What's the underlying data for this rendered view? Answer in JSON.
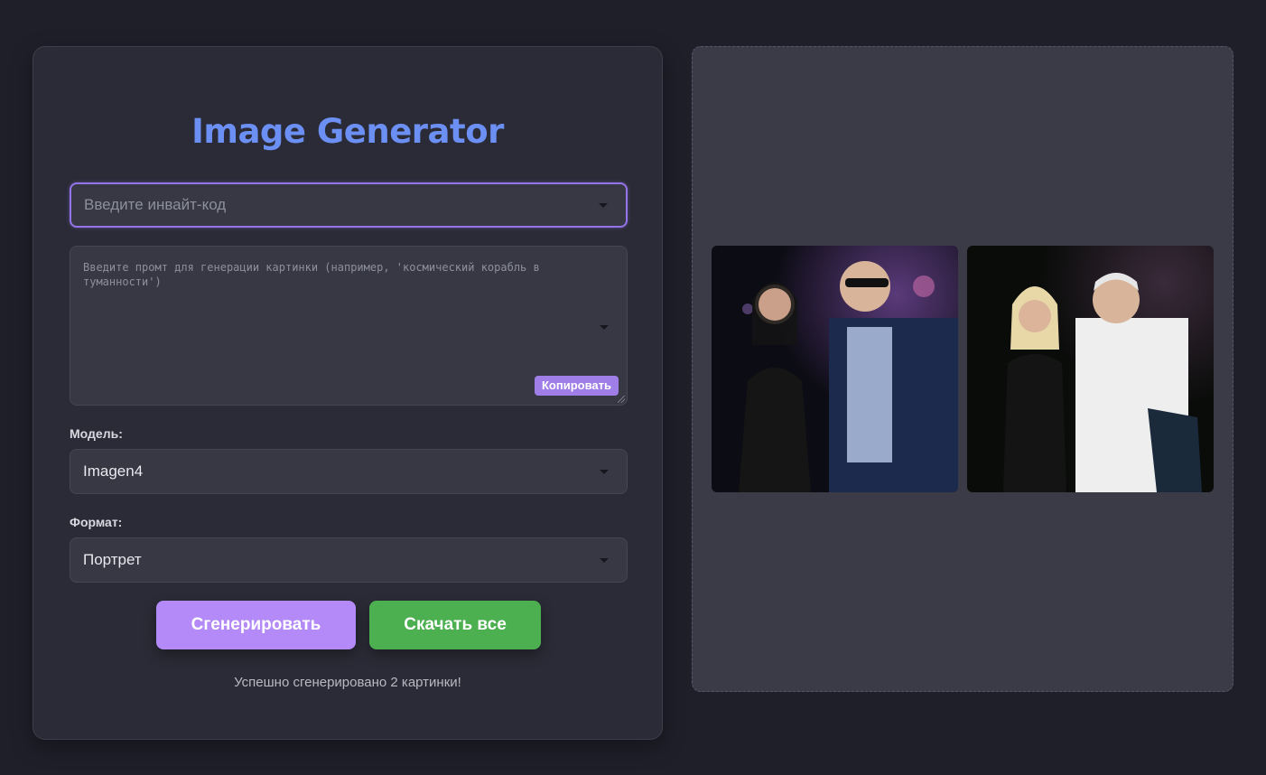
{
  "app": {
    "title": "Image Generator"
  },
  "form": {
    "invite_placeholder": "Введите инвайт-код",
    "prompt_placeholder": "Введите промт для генерации картинки (например, 'космический корабль в туманности')",
    "copy_label": "Копировать",
    "model_label": "Модель:",
    "model_value": "Imagen4",
    "format_label": "Формат:",
    "format_value": "Портрет",
    "generate_label": "Сгенерировать",
    "download_label": "Скачать все",
    "status": "Успешно сгенерировано 2 картинки!"
  },
  "colors": {
    "accent_title": "#6b8ff2",
    "accent_purple": "#b38af7",
    "accent_green": "#4caf50",
    "background": "#1e1f29"
  },
  "icons": [
    "chevron-down-icon"
  ]
}
